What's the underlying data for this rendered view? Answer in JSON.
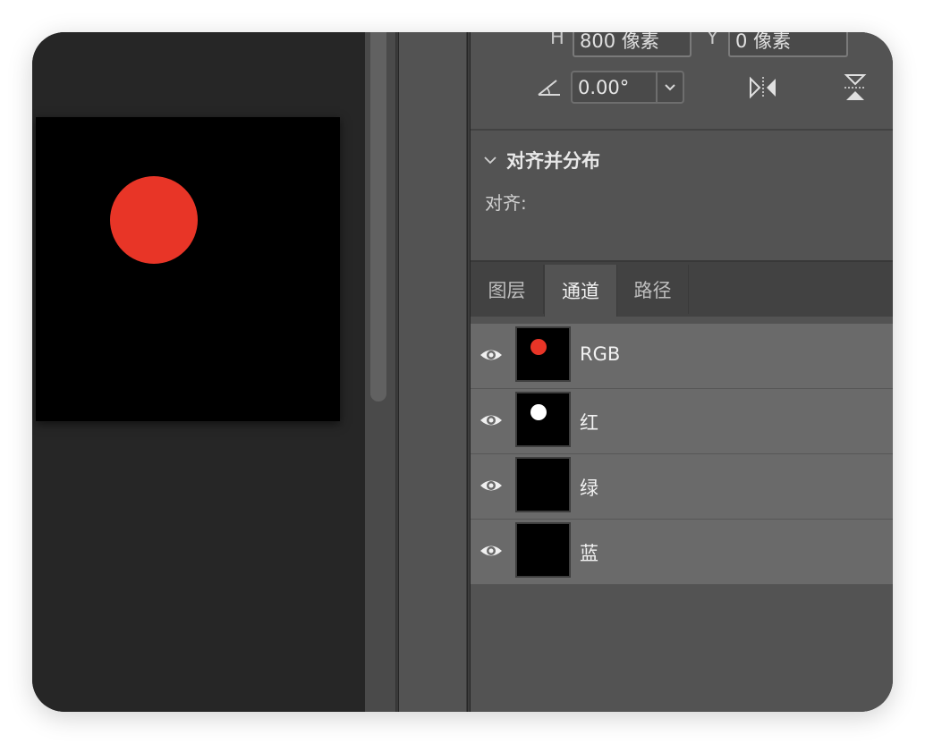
{
  "canvas": {
    "background": "#000000",
    "circle_color": "#e83527"
  },
  "transform": {
    "h_label": "H",
    "h_value": "800 像素",
    "y_label": "Y",
    "y_value": "0 像素",
    "angle_value": "0.00°",
    "angle_icon": "angle-icon",
    "flip_h_icon": "flip-horizontal-icon",
    "flip_v_icon": "flip-vertical-icon"
  },
  "align": {
    "section_title": "对齐并分布",
    "align_label": "对齐:"
  },
  "tabs": [
    {
      "label": "图层",
      "active": false
    },
    {
      "label": "通道",
      "active": true
    },
    {
      "label": "路径",
      "active": false
    }
  ],
  "channels": [
    {
      "name": "RGB",
      "thumb_dot": "#e83527"
    },
    {
      "name": "红",
      "thumb_dot": "#ffffff"
    },
    {
      "name": "绿",
      "thumb_dot": null
    },
    {
      "name": "蓝",
      "thumb_dot": null
    }
  ]
}
